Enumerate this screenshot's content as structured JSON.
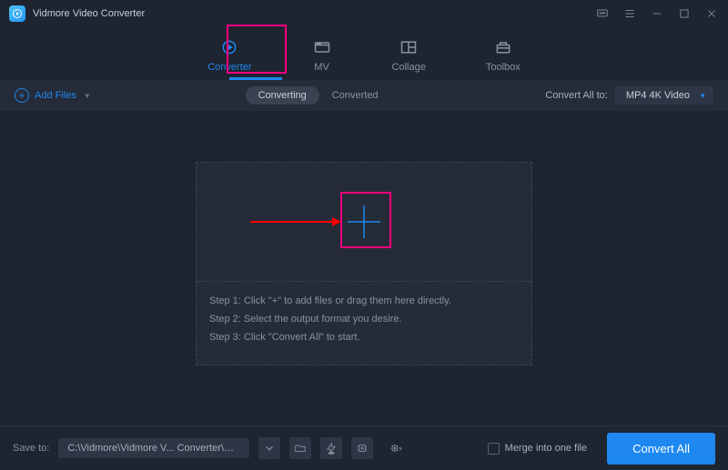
{
  "titlebar": {
    "title": "Vidmore Video Converter"
  },
  "nav": {
    "tabs": [
      {
        "label": "Converter"
      },
      {
        "label": "MV"
      },
      {
        "label": "Collage"
      },
      {
        "label": "Toolbox"
      }
    ]
  },
  "toolbar": {
    "add_files": "Add Files",
    "segments": [
      {
        "label": "Converting"
      },
      {
        "label": "Converted"
      }
    ],
    "convert_all_label": "Convert All to:",
    "format": "MP4 4K Video"
  },
  "dropzone": {
    "step1": "Step 1: Click \"+\" to add files or drag them here directly.",
    "step2": "Step 2: Select the output format you desire.",
    "step3": "Step 3: Click \"Convert All\" to start."
  },
  "bottom": {
    "save_label": "Save to:",
    "path": "C:\\Vidmore\\Vidmore V... Converter\\Converted",
    "merge_label": "Merge into one file",
    "convert_btn": "Convert All"
  }
}
